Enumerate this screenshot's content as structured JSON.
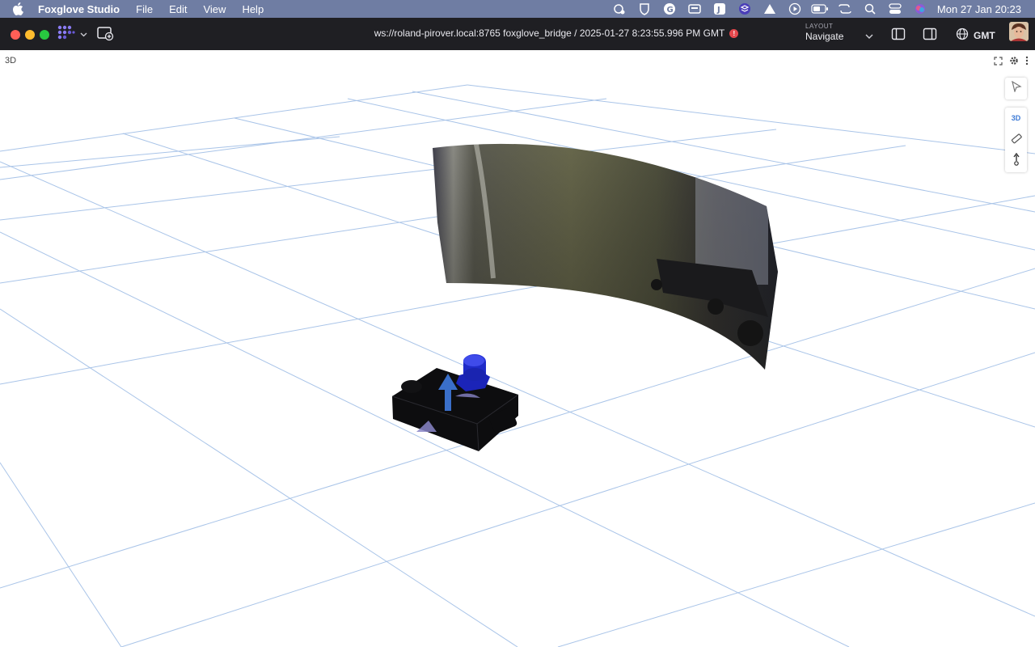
{
  "menubar": {
    "app_name": "Foxglove Studio",
    "menus": [
      "File",
      "Edit",
      "View",
      "Help"
    ],
    "clock": "Mon 27 Jan  20:23"
  },
  "toolbar": {
    "connection": "ws://roland-pirover.local:8765 foxglove_bridge / 2025-01-27 8:23:55.996 PM GMT",
    "layout_label": "LAYOUT",
    "layout_value": "Navigate",
    "timezone": "GMT"
  },
  "panel": {
    "title": "3D",
    "toolbox_mode": "3D"
  },
  "colors": {
    "menubar": "#6f7da3",
    "toolbar": "#1f1f23",
    "grid": "#a9c4e8",
    "robot_body": "#0d0d0f",
    "sensor": "#1f2fd0",
    "pose_arrow": "#3a6fc9",
    "error": "#e5484d"
  }
}
